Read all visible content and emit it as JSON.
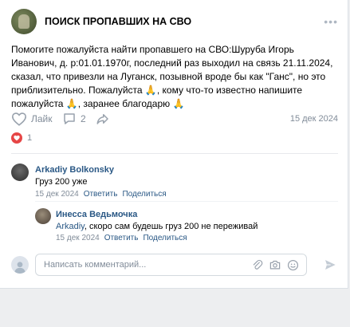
{
  "post": {
    "group_name": "ПОИСК ПРОПАВШИХ НА СВО",
    "text_before_1": "Помогите пожалуйста найти пропавшего на СВО:Шуруба Игорь Иванович, д. р:01.01.1970г, последний раз выходил на связь 21.11.2024, сказал, что привезли на Луганск, позывной вроде бы как \"Ганс\", но это приблизительно. Пожалуйста ",
    "text_before_2": ", кому что-то известно напишите пожалуйста ",
    "text_before_3": ", заранее благодарю ",
    "prayer_emoji": "🙏",
    "like_label": "Лайк",
    "comment_count": "2",
    "date": "15 дек 2024",
    "reaction_count": "1"
  },
  "comments": [
    {
      "author": "Arkadiy Bolkonsky",
      "text": "Груз 200 уже",
      "date": "15 дек 2024",
      "reply_label": "Ответить",
      "share_label": "Поделиться"
    },
    {
      "author": "Инесса Ведьмочка",
      "mention": "Arkadiy",
      "text": ", скоро сам будешь груз 200 не переживай",
      "date": "15 дек 2024",
      "reply_label": "Ответить",
      "share_label": "Поделиться"
    }
  ],
  "comment_input": {
    "placeholder": "Написать комментарий..."
  },
  "colors": {
    "accent": "#2a5885",
    "muted": "#818c99",
    "heart": "#e64646",
    "emoji": "#f5a623"
  },
  "icons": [
    "group-avatar",
    "more-icon",
    "heart-icon",
    "comment-icon",
    "share-icon",
    "heart-reaction-icon",
    "attach-icon",
    "camera-icon",
    "smile-icon",
    "send-icon"
  ]
}
